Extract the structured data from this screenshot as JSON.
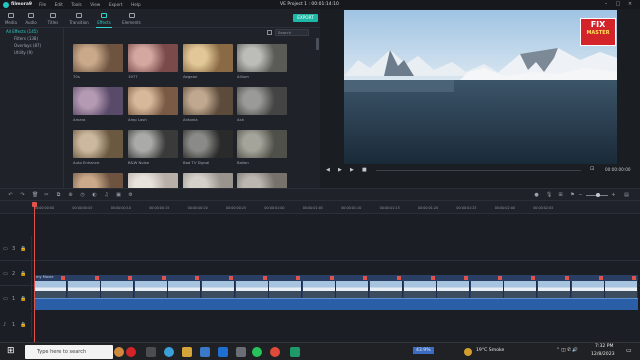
{
  "app": {
    "name": "filmora9",
    "project_title": "VE Project 1 : 00:01:14:10"
  },
  "menu": [
    "File",
    "Edit",
    "Tools",
    "View",
    "Export",
    "Help"
  ],
  "tabs": [
    "Media",
    "Audio",
    "Titles",
    "Transition",
    "Effects",
    "Elements"
  ],
  "active_tab": "Effects",
  "export_label": "EXPORT",
  "categories": [
    {
      "label": "All Effects (145)",
      "selected": true
    },
    {
      "label": "Filters (138)",
      "selected": false
    },
    {
      "label": "Overlays (87)",
      "selected": false
    },
    {
      "label": "Utility (9)",
      "selected": false
    }
  ],
  "search": {
    "placeholder": "Search"
  },
  "effects": [
    "70s",
    "1977",
    "Aegean",
    "Allium",
    "Amaro",
    "Amp Lash",
    "Antonia",
    "Ash",
    "Auto Enhance",
    "B&W Noise",
    "Bad TV Signal",
    "Ballan",
    "",
    "",
    "",
    ""
  ],
  "preview": {
    "time": "00:00:00:00",
    "watermark_line1": "FIX",
    "watermark_line2": "MASTER"
  },
  "ruler_ticks": [
    "00:00:00:00",
    "00:00:00:05",
    "00:00:00:10",
    "00:00:00:15",
    "00:00:00:20",
    "00:00:00:25",
    "00:00:01:00",
    "00:00:01:05",
    "00:00:01:10",
    "00:00:01:15",
    "00:00:01:20",
    "00:00:01:25",
    "00:00:02:00",
    "00:00:02:05"
  ],
  "track_labels": [
    "3",
    "2",
    "1",
    "1"
  ],
  "clip_label": "my Movie",
  "taskbar": {
    "search_placeholder": "Type here to search",
    "battery": "43.9%",
    "weather": "19°C  Smoke",
    "time": "7:32 PM",
    "date": "12/8/2023"
  },
  "colors": {
    "accent": "#2ed3cb",
    "export": "#1fb7a6",
    "audio_clip": "#2a5fa8",
    "video_clip": "#2a3e64",
    "playhead": "#e0534a"
  }
}
